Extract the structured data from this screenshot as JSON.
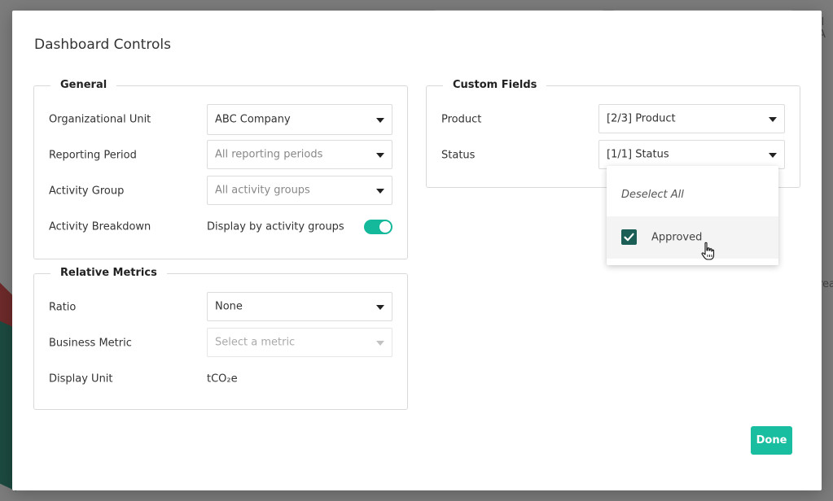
{
  "background": {
    "partial_text_top": "ll A",
    "partial_text_mid": "rea"
  },
  "modal": {
    "title": "Dashboard Controls",
    "general": {
      "legend": "General",
      "org_unit": {
        "label": "Organizational Unit",
        "value": "ABC Company"
      },
      "reporting_period": {
        "label": "Reporting Period",
        "placeholder": "All reporting periods"
      },
      "activity_group": {
        "label": "Activity Group",
        "placeholder": "All activity groups"
      },
      "activity_breakdown": {
        "label": "Activity Breakdown",
        "value": "Display by activity groups",
        "toggle_on": true
      }
    },
    "relative_metrics": {
      "legend": "Relative Metrics",
      "ratio": {
        "label": "Ratio",
        "value": "None"
      },
      "business_metric": {
        "label": "Business Metric",
        "placeholder": "Select a metric"
      },
      "display_unit": {
        "label": "Display Unit",
        "value": "tCO₂e"
      }
    },
    "custom_fields": {
      "legend": "Custom Fields",
      "product": {
        "label": "Product",
        "value": "[2/3] Product"
      },
      "status": {
        "label": "Status",
        "value": "[1/1] Status"
      }
    },
    "status_dropdown": {
      "deselect_all": "Deselect All",
      "options": [
        {
          "label": "Approved",
          "checked": true
        }
      ]
    },
    "done_label": "Done"
  },
  "colors": {
    "accent": "#19bd9f",
    "toggle": "#14b89b",
    "checkbox": "#1a5e55"
  }
}
